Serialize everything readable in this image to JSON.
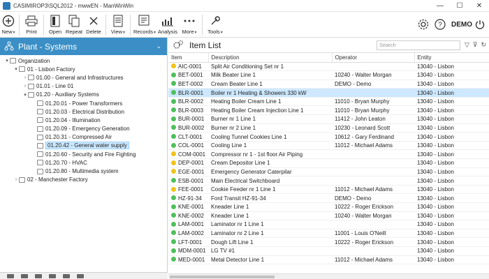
{
  "window": {
    "title": "CASIMIROP3\\SQL2012 - mwwEN - ManWinWin"
  },
  "toolbar": {
    "new": "New",
    "print": "Print",
    "open": "Open",
    "repeat": "Repeat",
    "delete": "Delete",
    "view": "View",
    "records": "Records",
    "analysis": "Analysis",
    "more": "More",
    "tools": "Tools",
    "user": "DEMO"
  },
  "left": {
    "title": "Plant - Systems",
    "tree": [
      {
        "label": "Organization",
        "level": 0,
        "exp": "▾"
      },
      {
        "label": "01 - Lisbon Factory",
        "level": 1,
        "exp": "▾"
      },
      {
        "label": "01.00 - General and Infrastructures",
        "level": 2,
        "exp": "›"
      },
      {
        "label": "01.01 - Line 01",
        "level": 2,
        "exp": "›"
      },
      {
        "label": "01.20 - Auxiliary Systems",
        "level": 2,
        "exp": "▾"
      },
      {
        "label": "01.20.01 - Power Transformers",
        "level": 3,
        "exp": ""
      },
      {
        "label": "01.20.03 - Electrical Distribution",
        "level": 3,
        "exp": ""
      },
      {
        "label": "01.20.04 - Illumination",
        "level": 3,
        "exp": ""
      },
      {
        "label": "01.20.09 - Emergency Generation",
        "level": 3,
        "exp": ""
      },
      {
        "label": "01.20.31 - Compressed Air",
        "level": 3,
        "exp": ""
      },
      {
        "label": "01.20.42 - General water supply",
        "level": 3,
        "exp": "",
        "selected": true
      },
      {
        "label": "01.20.60 - Security and Fire Fighting",
        "level": 3,
        "exp": ""
      },
      {
        "label": "01.20.70 - HVAC",
        "level": 3,
        "exp": ""
      },
      {
        "label": "01.20.80 - Multimedia system",
        "level": 3,
        "exp": ""
      },
      {
        "label": "02 - Manchester Factory",
        "level": 1,
        "exp": "›"
      }
    ]
  },
  "right": {
    "title": "Item List",
    "search_placeholder": "Search",
    "columns": [
      "Item",
      "Description",
      "Operator",
      "Entity"
    ],
    "rows": [
      {
        "status": "yellow",
        "item": "AIC-0001",
        "desc": "Split Air Conditioning Set nr 1",
        "op": "",
        "entity": "13040 - Lisbon"
      },
      {
        "status": "green",
        "item": "BET-0001",
        "desc": "Milk Beater Line 1",
        "op": "10240 - Walter Morgan",
        "entity": "13040 - Lisbon"
      },
      {
        "status": "green",
        "item": "BET-0002",
        "desc": "Cream Beater Line 1",
        "op": "DEMO - Demo",
        "entity": "13040 - Lisbon"
      },
      {
        "status": "green",
        "item": "BLR-0001",
        "desc": "Boiler nr 1 Heating & Showers 330 kW",
        "op": "",
        "entity": "13040 - Lisbon",
        "selected": true
      },
      {
        "status": "green",
        "item": "BLR-0002",
        "desc": "Heating Boiler Cream Line 1",
        "op": "11010 - Bryan Murphy",
        "entity": "13040 - Lisbon"
      },
      {
        "status": "green",
        "item": "BLR-0003",
        "desc": "Heating Boiler Cream Injection Line 1",
        "op": "11010 - Bryan Murphy",
        "entity": "13040 - Lisbon"
      },
      {
        "status": "green",
        "item": "BUR-0001",
        "desc": "Burner nr 1 Line 1",
        "op": "11412 - John Leaton",
        "entity": "13040 - Lisbon"
      },
      {
        "status": "green",
        "item": "BUR-0002",
        "desc": "Burner nr 2 Line 1",
        "op": "10230 - Leonard Scott",
        "entity": "13040 - Lisbon"
      },
      {
        "status": "green",
        "item": "CLT-0001",
        "desc": "Cooling Tunnel Cookies Line 1",
        "op": "10612 - Gary Ferdinand",
        "entity": "13040 - Lisbon"
      },
      {
        "status": "green",
        "item": "COL-0001",
        "desc": "Cooling Line 1",
        "op": "11012 - Michael Adams",
        "entity": "13040 - Lisbon"
      },
      {
        "status": "yellow",
        "item": "COM-0001",
        "desc": "Compressor nr 1 - 1st floor Air Piping",
        "op": "",
        "entity": "13040 - Lisbon"
      },
      {
        "status": "yellow",
        "item": "DEP-0001",
        "desc": "Cream Depositor Line 1",
        "op": "",
        "entity": "13040 - Lisbon"
      },
      {
        "status": "yellow",
        "item": "EGE-0001",
        "desc": "Emergency Generator Caterpilar",
        "op": "",
        "entity": "13040 - Lisbon"
      },
      {
        "status": "green",
        "item": "ESB-0001",
        "desc": "Main Electrical Switchboard",
        "op": "",
        "entity": "13040 - Lisbon"
      },
      {
        "status": "yellow",
        "item": "FEE-0001",
        "desc": "Cookie Feeder nr 1 Line 1",
        "op": "11012 - Michael Adams",
        "entity": "13040 - Lisbon"
      },
      {
        "status": "green",
        "item": "HZ-91-34",
        "desc": "Ford Transit HZ-91-34",
        "op": "DEMO - Demo",
        "entity": "13040 - Lisbon"
      },
      {
        "status": "green",
        "item": "KNE-0001",
        "desc": "Kneader Line 1",
        "op": "10222 - Roger Erickson",
        "entity": "13040 - Lisbon"
      },
      {
        "status": "green",
        "item": "KNE-0002",
        "desc": "Kneader Line 1",
        "op": "10240 - Walter Morgan",
        "entity": "13040 - Lisbon"
      },
      {
        "status": "green",
        "item": "LAM-0001",
        "desc": "Laminator nr 1 Line 1",
        "op": "",
        "entity": "13040 - Lisbon"
      },
      {
        "status": "green",
        "item": "LAM-0002",
        "desc": "Laminator nr 2 Line 1",
        "op": "11001 - Louis O'Neill",
        "entity": "13040 - Lisbon"
      },
      {
        "status": "green",
        "item": "LFT-0001",
        "desc": "Dough Lift Line 1",
        "op": "10222 - Roger Erickson",
        "entity": "13040 - Lisbon"
      },
      {
        "status": "green",
        "item": "MDM-0001",
        "desc": "LG TV #1",
        "op": "",
        "entity": "13040 - Lisbon"
      },
      {
        "status": "green",
        "item": "MED-0001",
        "desc": "Metal Detector Line 1",
        "op": "11012 - Michael Adams",
        "entity": "13040 - Lisbon"
      }
    ]
  }
}
